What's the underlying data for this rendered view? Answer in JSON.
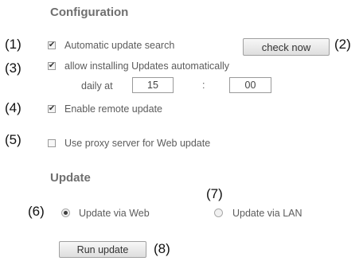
{
  "configuration": {
    "title": "Configuration",
    "automatic_update_search": {
      "marker": "(1)",
      "checked": true,
      "label": "Automatic update search"
    },
    "check_now": {
      "marker": "(2)",
      "label": "check now"
    },
    "allow_installing": {
      "marker": "(3)",
      "checked": true,
      "label": "allow installing Updates automatically",
      "daily_at_label": "daily at",
      "hour_value": "15",
      "separator": ":",
      "minute_value": "00"
    },
    "remote_update": {
      "marker": "(4)",
      "checked": true,
      "label": "Enable remote update"
    },
    "proxy": {
      "marker": "(5)",
      "checked": false,
      "label": "Use proxy server for Web update"
    }
  },
  "update": {
    "title": "Update",
    "via_web": {
      "marker": "(6)",
      "selected": true,
      "label": "Update via Web"
    },
    "via_lan": {
      "marker": "(7)",
      "selected": false,
      "label": "Update via LAN"
    },
    "run_update": {
      "marker": "(8)",
      "label": "Run update"
    }
  },
  "checkmark_glyph": "✔"
}
